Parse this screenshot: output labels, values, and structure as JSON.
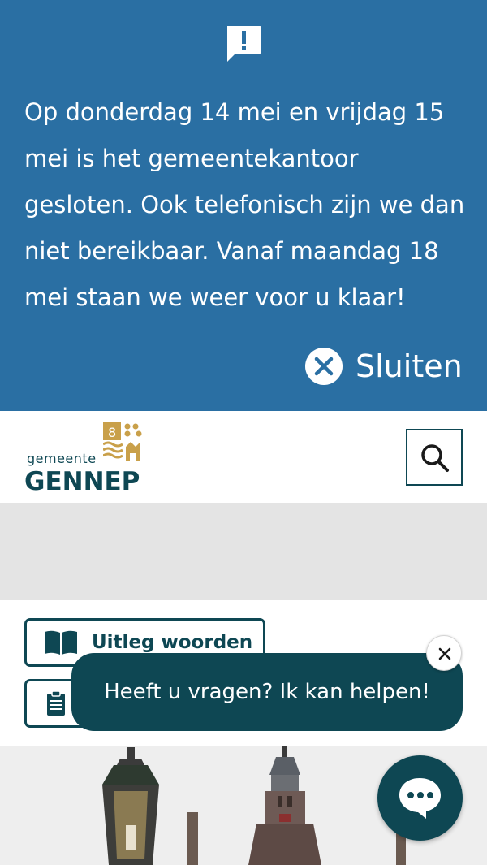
{
  "alert": {
    "icon": "exclamation-speech-icon",
    "message": "Op donderdag 14 mei en vrijdag 15 mei is het gemeentekantoor gesloten. Ook telefonisch zijn we dan niet bereikbaar. Vanaf maandag 18 mei staan we weer voor u klaar!",
    "close_label": "Sluiten",
    "close_icon": "close-circle-icon",
    "background": "#2a6fa3"
  },
  "header": {
    "logo_small": "gemeente",
    "logo_name": "GENNEP",
    "logo_color": "#0e4753",
    "crest_color": "#c9a04a",
    "search_icon": "search-icon"
  },
  "buttons": {
    "words_label": "Uitleg woorden",
    "words_icon": "book-icon",
    "second_icon": "clipboard-icon"
  },
  "chat": {
    "prompt": "Heeft u vragen? Ik kan helpen!",
    "close_icon": "close-icon",
    "fab_icon": "chat-bubble-icon",
    "color": "#0e4753"
  }
}
